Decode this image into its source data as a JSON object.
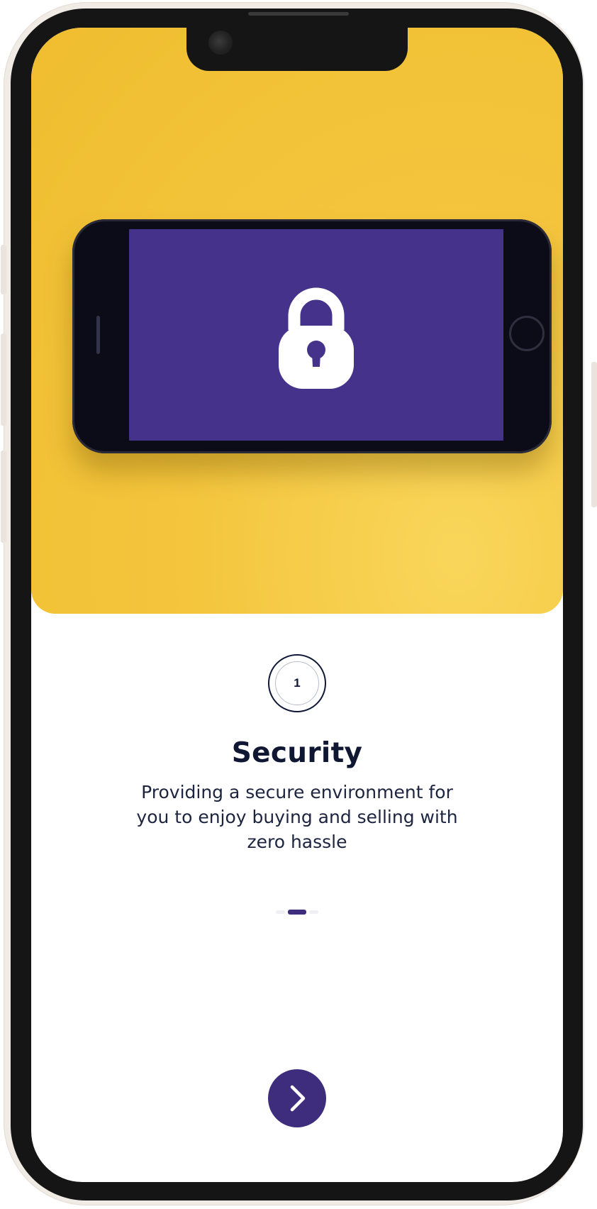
{
  "onboarding": {
    "step_number": "1",
    "title": "Security",
    "description": "Providing a secure environment for you to enjoy buying and selling with zero hassle",
    "pagination": {
      "total": 3,
      "active_index": 1
    },
    "next_button_icon": "chevron-right-icon",
    "hero_icon": "padlock-icon"
  },
  "colors": {
    "accent": "#3e2d7c",
    "text_dark": "#0f1733",
    "hero_background": "#f4c53d",
    "hero_screen": "#45328a"
  }
}
